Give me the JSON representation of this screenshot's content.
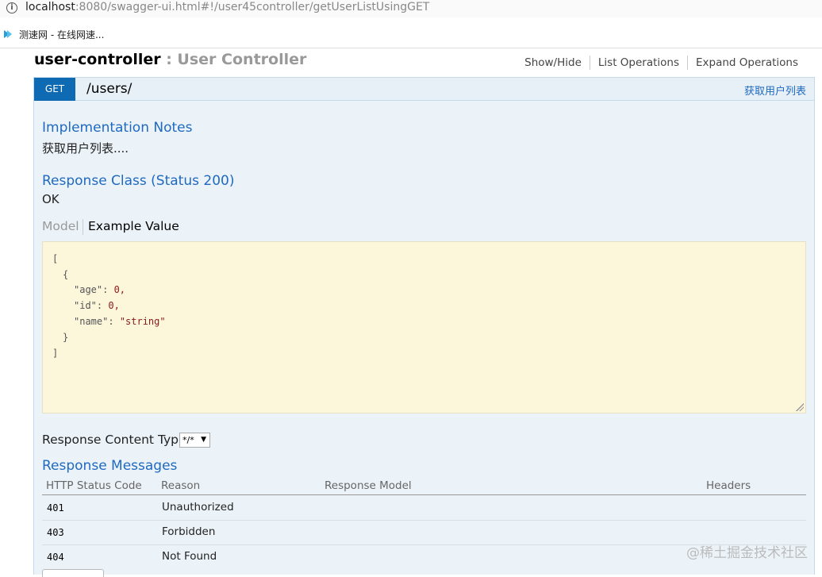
{
  "browser": {
    "url_host": "localhost",
    "url_rest": ":8080/swagger-ui.html#!/user45controller/getUserListUsingGET",
    "bookmark_label": "测速网 - 在线网速..."
  },
  "controller": {
    "name": "user-controller",
    "description": " : User Controller",
    "ops": [
      "Show/Hide",
      "List Operations",
      "Expand Operations"
    ]
  },
  "operation": {
    "method": "GET",
    "path": "/users/",
    "summary": "获取用户列表",
    "notes_title": "Implementation Notes",
    "notes_text": "获取用户列表....",
    "response_class_title": "Response Class (Status 200)",
    "response_class_value": "OK",
    "tab_model": "Model",
    "tab_example": "Example Value",
    "example_json": {
      "open_bracket": "[",
      "open_brace": "{",
      "age_key": "\"age\"",
      "age_val": "0,",
      "id_key": "\"id\"",
      "id_val": "0,",
      "name_key": "\"name\"",
      "name_val": "\"string\"",
      "close_brace": "}",
      "close_bracket": "]"
    },
    "content_type_label": "Response Content Type",
    "content_type_value": "*/*",
    "messages_title": "Response Messages",
    "table_headers": [
      "HTTP Status Code",
      "Reason",
      "Response Model",
      "Headers"
    ],
    "rows": [
      {
        "code": "401",
        "reason": "Unauthorized"
      },
      {
        "code": "403",
        "reason": "Forbidden"
      },
      {
        "code": "404",
        "reason": "Not Found"
      }
    ]
  },
  "watermark": "@稀土掘金技术社区",
  "colors": {
    "get_badge": "#0f6ab4",
    "op_bg": "#ebf3f9",
    "link": "#1f69c0",
    "example_bg": "#fcf6db"
  }
}
